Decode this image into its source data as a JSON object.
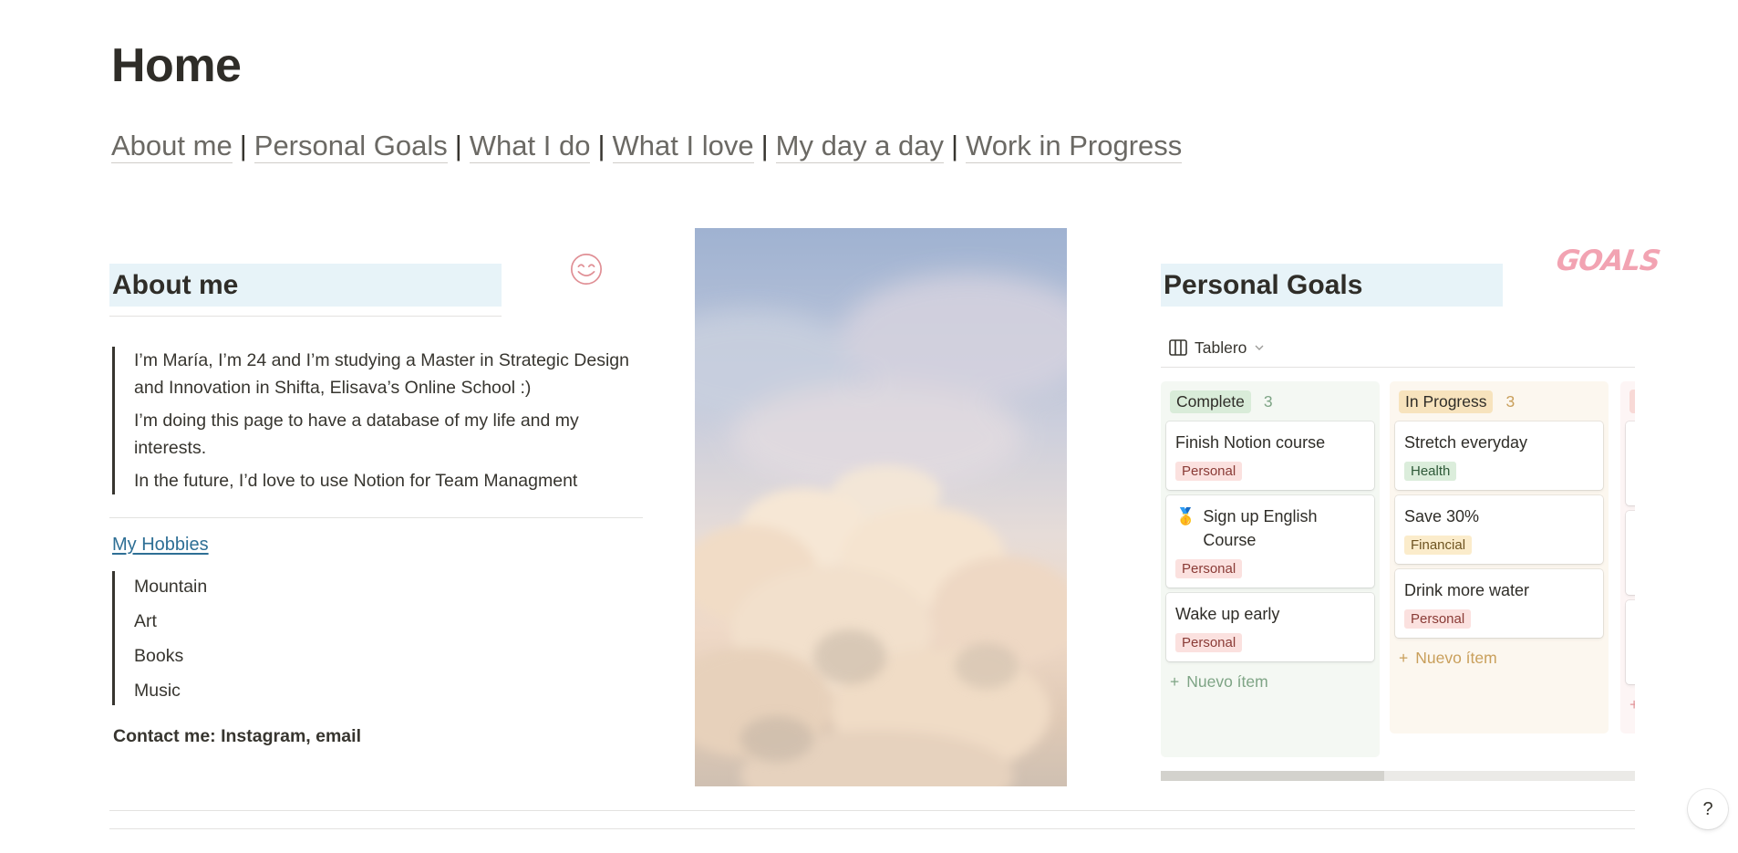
{
  "page": {
    "title": "Home"
  },
  "nav": {
    "links": [
      "About me",
      "Personal Goals",
      "What I do",
      "What I love",
      "My day a day",
      "Work in Progress"
    ],
    "separator": "|"
  },
  "about": {
    "heading": "About me",
    "paragraphs": [
      "I’m María, I’m 24 and I’m studying a Master in Strategic Design and Innovation in Shifta, Elisava’s Online School :)",
      "I’m doing this page to have a database of my life and my interests.",
      "In the future, I’d love to use Notion for Team Managment"
    ],
    "hobbies_link": "My Hobbies",
    "hobbies": [
      "Mountain",
      "Art",
      "Books",
      "Music"
    ],
    "contact": "Contact me: Instagram, email",
    "icon": "smile-icon"
  },
  "goals": {
    "heading": "Personal Goals",
    "sticker": "GOALS",
    "view_label": "Tablero",
    "new_item_label": "Nuevo ítem",
    "columns": [
      {
        "name": "Complete",
        "count": "3",
        "cards": [
          {
            "title": "Finish Notion course",
            "tag": "Personal",
            "emoji": ""
          },
          {
            "title": "Sign up English Course",
            "tag": "Personal",
            "emoji": "🥇"
          },
          {
            "title": "Wake up early",
            "tag": "Personal",
            "emoji": ""
          }
        ]
      },
      {
        "name": "In Progress",
        "count": "3",
        "cards": [
          {
            "title": "Stretch everyday",
            "tag": "Health"
          },
          {
            "title": "Save 30%",
            "tag": "Financial"
          },
          {
            "title": "Drink more water",
            "tag": "Personal"
          }
        ]
      }
    ]
  },
  "help": {
    "label": "?"
  },
  "colors": {
    "heading_bg": "#e7f3f8",
    "link": "#2e6f95",
    "tag_personal": "#fbe1df",
    "tag_health": "#dbeddb",
    "tag_financial": "#fbeccb"
  }
}
